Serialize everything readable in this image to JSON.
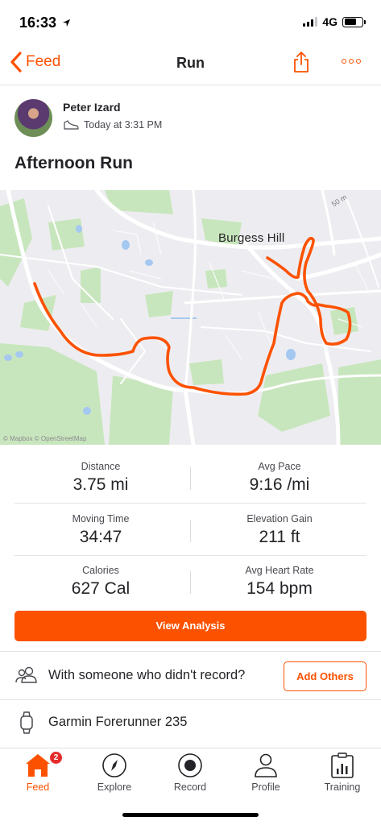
{
  "status_bar": {
    "time": "16:33",
    "network": "4G",
    "battery_level": 0.7
  },
  "nav": {
    "back_label": "Feed",
    "title": "Run",
    "icons": [
      "chevron-left-icon",
      "share-icon",
      "more-icon"
    ]
  },
  "athlete": {
    "name": "Peter Izard",
    "time": "Today at 3:31 PM"
  },
  "activity": {
    "title": "Afternoon Run"
  },
  "map": {
    "place_label": "Burgess Hill",
    "road_label": "50 m",
    "credit": "© Mapbox © OpenStreetMap",
    "route_color": "#fc5200"
  },
  "stats": [
    {
      "label": "Distance",
      "value": "3.75 mi"
    },
    {
      "label": "Avg Pace",
      "value": "9:16 /mi"
    },
    {
      "label": "Moving Time",
      "value": "34:47"
    },
    {
      "label": "Elevation Gain",
      "value": "211 ft"
    },
    {
      "label": "Calories",
      "value": "627 Cal"
    },
    {
      "label": "Avg Heart Rate",
      "value": "154 bpm"
    }
  ],
  "actions": {
    "view_analysis": "View Analysis",
    "with_someone": "With someone who didn't record?",
    "add_others": "Add Others",
    "device": "Garmin Forerunner 235"
  },
  "tabs": [
    {
      "label": "Feed",
      "icon": "home-icon",
      "badge": "2",
      "active": true
    },
    {
      "label": "Explore",
      "icon": "compass-icon"
    },
    {
      "label": "Record",
      "icon": "record-icon"
    },
    {
      "label": "Profile",
      "icon": "profile-icon"
    },
    {
      "label": "Training",
      "icon": "training-icon"
    }
  ],
  "colors": {
    "accent": "#fc5200",
    "badge": "#e32c2c",
    "map_green": "#bfe3b4"
  }
}
